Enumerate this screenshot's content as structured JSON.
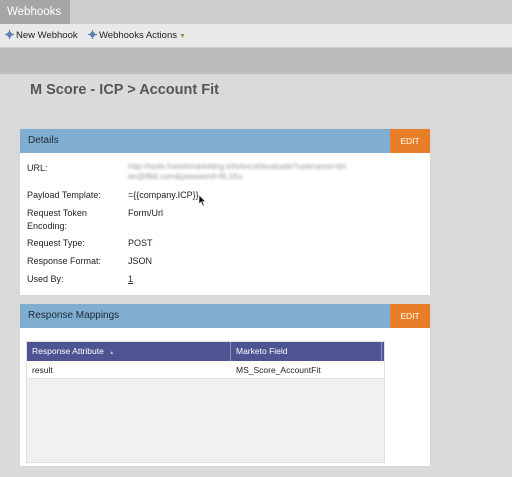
{
  "tabs": [
    {
      "label": "Webhooks"
    }
  ],
  "toolbar": {
    "new_label": "New Webhook",
    "actions_label": "Webhooks Actions",
    "actions_caret": "▼"
  },
  "page": {
    "title": "M Score - ICP > Account Fit"
  },
  "details": {
    "header": "Details",
    "edit_label": "EDIT",
    "rows": [
      {
        "label": "URL:",
        "value": "http://tools.hooshmarketing.info/excel/evaluate?username=bri an@8bit.com&password=9L1Ku"
      },
      {
        "label": "Payload Template:",
        "value": "={{company.ICP}}"
      },
      {
        "label": "Request Token Encoding:",
        "value": "Form/Url"
      },
      {
        "label": "Request Type:",
        "value": "POST"
      },
      {
        "label": "Response Format:",
        "value": "JSON"
      },
      {
        "label": "Used By:",
        "value": "1"
      }
    ]
  },
  "mappings": {
    "header": "Response Mappings",
    "edit_label": "EDIT",
    "columns": [
      "Response Attribute",
      "Marketo Field"
    ],
    "sort_indicator": "▲",
    "rows": [
      {
        "attribute": "result",
        "field": "MS_Score_AccountFit"
      }
    ]
  },
  "colors": {
    "panel_header": "#7faed0",
    "edit_button": "#e87e27",
    "grid_header": "#4e5392"
  }
}
